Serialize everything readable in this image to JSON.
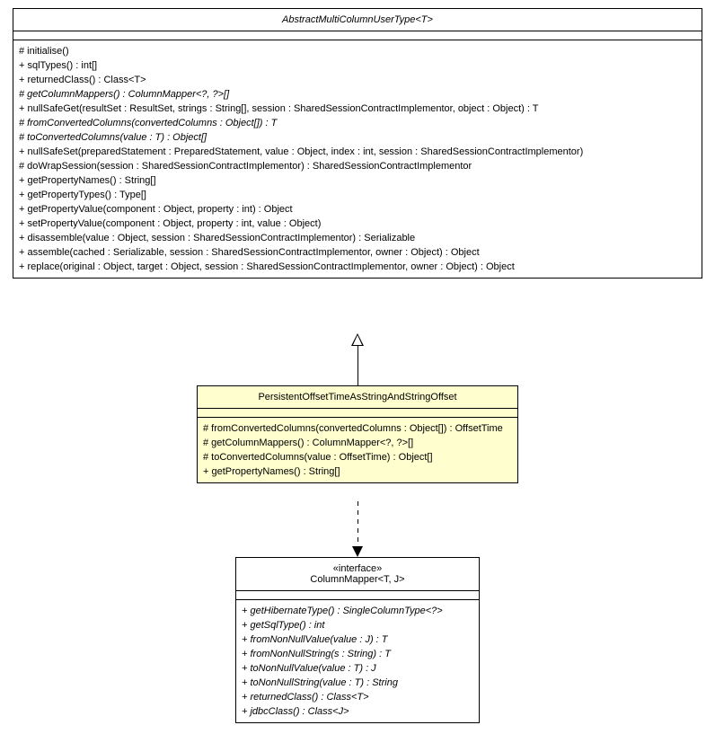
{
  "classA": {
    "name": "AbstractMultiColumnUserType<T>",
    "ops": [
      {
        "t": "# initialise()",
        "abs": false
      },
      {
        "t": "+ sqlTypes() : int[]",
        "abs": false
      },
      {
        "t": "+ returnedClass() : Class<T>",
        "abs": false
      },
      {
        "t": "# getColumnMappers() : ColumnMapper<?, ?>[]",
        "abs": true
      },
      {
        "t": "+ nullSafeGet(resultSet : ResultSet, strings : String[], session : SharedSessionContractImplementor, object : Object) : T",
        "abs": false
      },
      {
        "t": "# fromConvertedColumns(convertedColumns : Object[]) : T",
        "abs": true
      },
      {
        "t": "# toConvertedColumns(value : T) : Object[]",
        "abs": true
      },
      {
        "t": "+ nullSafeSet(preparedStatement : PreparedStatement, value : Object, index : int, session : SharedSessionContractImplementor)",
        "abs": false
      },
      {
        "t": "# doWrapSession(session : SharedSessionContractImplementor) : SharedSessionContractImplementor",
        "abs": false
      },
      {
        "t": "+ getPropertyNames() : String[]",
        "abs": false
      },
      {
        "t": "+ getPropertyTypes() : Type[]",
        "abs": false
      },
      {
        "t": "+ getPropertyValue(component : Object, property : int) : Object",
        "abs": false
      },
      {
        "t": "+ setPropertyValue(component : Object, property : int, value : Object)",
        "abs": false
      },
      {
        "t": "+ disassemble(value : Object, session : SharedSessionContractImplementor) : Serializable",
        "abs": false
      },
      {
        "t": "+ assemble(cached : Serializable, session : SharedSessionContractImplementor, owner : Object) : Object",
        "abs": false
      },
      {
        "t": "+ replace(original : Object, target : Object, session : SharedSessionContractImplementor, owner : Object) : Object",
        "abs": false
      }
    ]
  },
  "classB": {
    "name": "PersistentOffsetTimeAsStringAndStringOffset",
    "ops": [
      {
        "t": "# fromConvertedColumns(convertedColumns : Object[]) : OffsetTime",
        "abs": false
      },
      {
        "t": "# getColumnMappers() : ColumnMapper<?, ?>[]",
        "abs": false
      },
      {
        "t": "# toConvertedColumns(value : OffsetTime) : Object[]",
        "abs": false
      },
      {
        "t": "+ getPropertyNames() : String[]",
        "abs": false
      }
    ]
  },
  "classC": {
    "stereotype": "«interface»",
    "name": "ColumnMapper<T, J>",
    "ops": [
      {
        "t": "+ getHibernateType() : SingleColumnType<?>",
        "abs": true
      },
      {
        "t": "+ getSqlType() : int",
        "abs": true
      },
      {
        "t": "+ fromNonNullValue(value : J) : T",
        "abs": true
      },
      {
        "t": "+ fromNonNullString(s : String) : T",
        "abs": true
      },
      {
        "t": "+ toNonNullValue(value : T) : J",
        "abs": true
      },
      {
        "t": "+ toNonNullString(value : T) : String",
        "abs": true
      },
      {
        "t": "+ returnedClass() : Class<T>",
        "abs": true
      },
      {
        "t": "+ jdbcClass() : Class<J>",
        "abs": true
      }
    ]
  },
  "chart_data": {
    "type": "uml-class-diagram",
    "classes": [
      {
        "id": "A",
        "name": "AbstractMultiColumnUserType<T>",
        "abstract": true
      },
      {
        "id": "B",
        "name": "PersistentOffsetTimeAsStringAndStringOffset",
        "abstract": false
      },
      {
        "id": "C",
        "name": "ColumnMapper<T, J>",
        "stereotype": "interface",
        "abstract": true
      }
    ],
    "relations": [
      {
        "from": "B",
        "to": "A",
        "type": "generalization"
      },
      {
        "from": "B",
        "to": "C",
        "type": "dependency"
      }
    ]
  }
}
